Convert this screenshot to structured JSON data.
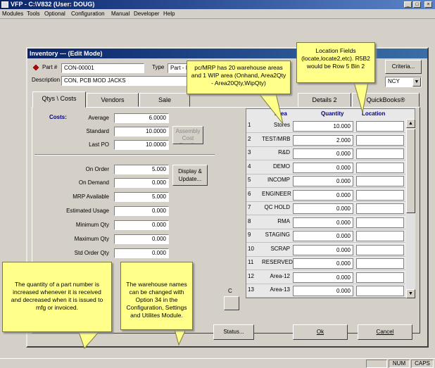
{
  "app": {
    "title": "VFP - C:\\V832  (User: DOUG)",
    "minimize": "_",
    "maximize": "□",
    "close": "×",
    "menu": [
      "Modules",
      "Tools",
      "Optional",
      "Configuration",
      "Manual",
      "Developer",
      "Help"
    ],
    "status": [
      "NUM",
      "CAPS"
    ]
  },
  "inventory": {
    "title": "Inventory --- (Edit Mode)",
    "part_label": "Part #",
    "part_value": "CON-00001",
    "type_label": "Type",
    "type_value": "Part - In",
    "desc_label": "Description",
    "desc_value": "CON, PCB MOD JACKS",
    "criteria_button": "Criteria...",
    "right_select_value": "NCY",
    "tabs": [
      "Qtys \\ Costs",
      "Vendors",
      "Sale",
      "Details 2",
      "QuickBooks®"
    ],
    "costs": {
      "heading": "Costs:",
      "average_label": "Average",
      "average_value": "6.0000",
      "standard_label": "Standard",
      "standard_value": "10.0000",
      "lastpo_label": "Last PO",
      "lastpo_value": "10.0000",
      "assembly_button": "Assembly Cost Details"
    },
    "qtys": [
      {
        "label": "On Order",
        "value": "5.000"
      },
      {
        "label": "On Demand",
        "value": "0.000"
      },
      {
        "label": "MRP Available",
        "value": "5.000"
      },
      {
        "label": "Estimated Usage",
        "value": "0.000"
      },
      {
        "label": "Minimum Qty",
        "value": "0.000"
      },
      {
        "label": "Maximum Qty",
        "value": "0.000"
      },
      {
        "label": "Std Order Qty",
        "value": "0.000"
      }
    ],
    "display_update_button": "Display & Update...",
    "hidden_c": "C",
    "status_button": "Status...",
    "ok_button": "Ok",
    "cancel_button": "Cancel",
    "grid": {
      "col_area": "Area",
      "col_quantity": "Quantity",
      "col_location": "Location",
      "rows": [
        {
          "num": "1",
          "name": "Stores",
          "qty": "10.000",
          "loc": ""
        },
        {
          "num": "2",
          "name": "TEST/MRB",
          "qty": "2.000",
          "loc": ""
        },
        {
          "num": "3",
          "name": "R&D",
          "qty": "0.000",
          "loc": ""
        },
        {
          "num": "4",
          "name": "DEMO",
          "qty": "0.000",
          "loc": ""
        },
        {
          "num": "5",
          "name": "INCOMP",
          "qty": "0.000",
          "loc": ""
        },
        {
          "num": "6",
          "name": "ENGINEER",
          "qty": "0.000",
          "loc": ""
        },
        {
          "num": "7",
          "name": "QC HOLD",
          "qty": "0.000",
          "loc": ""
        },
        {
          "num": "8",
          "name": "RMA",
          "qty": "0.000",
          "loc": ""
        },
        {
          "num": "9",
          "name": "STAGING",
          "qty": "0.000",
          "loc": ""
        },
        {
          "num": "10",
          "name": "SCRAP",
          "qty": "0.000",
          "loc": ""
        },
        {
          "num": "11",
          "name": "RESERVED",
          "qty": "0.000",
          "loc": ""
        },
        {
          "num": "12",
          "name": "Area-12",
          "qty": "0.000",
          "loc": ""
        },
        {
          "num": "13",
          "name": "Area-13",
          "qty": "0.000",
          "loc": ""
        }
      ]
    }
  },
  "callouts": {
    "warehouse": "pc/MRP has 20 warehouse areas and 1 WIP area (Onhand, Area2Qty - Area20Qty,WipQty)",
    "location": "Location Fields (locate,locate2,etc). R5B2 would be Row 5 Bin 2",
    "quantity": "The quantity of a part number is increased whenever it is received and decreased when it is issued to mfg or invoiced.",
    "names": "The warehouse names can be changed with Option 34 in the Configuration, Settings and Utilites Module."
  },
  "colors": {
    "titlebar": "#0a246a",
    "callout": "#ffff8a",
    "grid_header": "#000080"
  },
  "icons": {
    "app": "app-icon",
    "part": "red-diamond-icon"
  }
}
